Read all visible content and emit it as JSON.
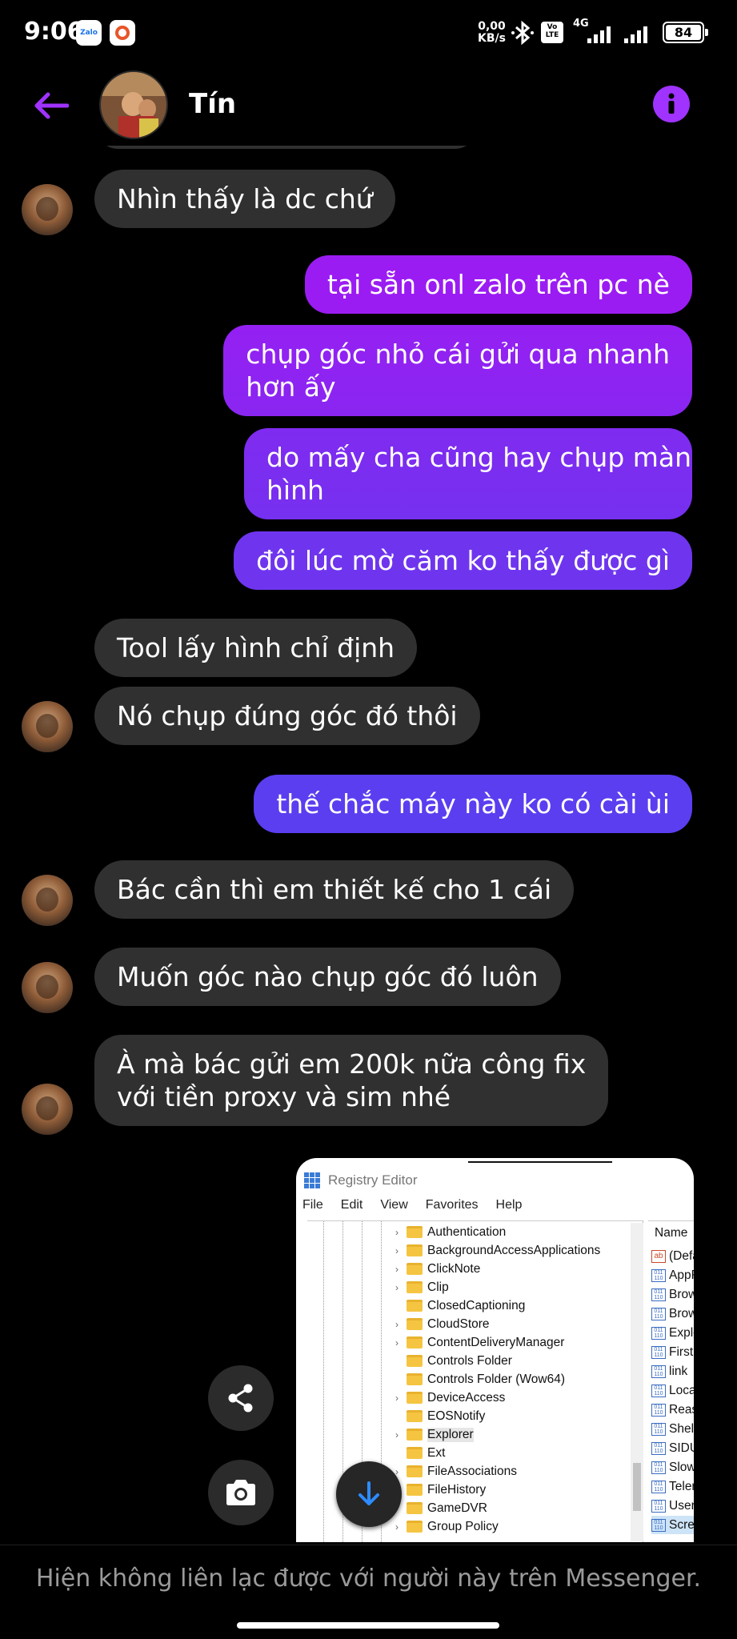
{
  "status_bar": {
    "time": "9:06",
    "zalo_badge": "Zalo",
    "net_speed_value": "0,00",
    "net_speed_unit": "KB/s",
    "volte_top": "Vo",
    "volte_bottom": "LTE",
    "network_type": "4G",
    "battery_level": "84"
  },
  "header": {
    "contact_name": "Tín",
    "back_icon": "back-arrow-icon",
    "info_icon": "info-icon"
  },
  "messages": [
    {
      "id": "m1",
      "side": "in",
      "text": "Nhìn thấy là dc chứ"
    },
    {
      "id": "m2",
      "side": "out",
      "text": "tại sẵn onl zalo trên pc nè"
    },
    {
      "id": "m3",
      "side": "out",
      "lines": [
        "chụp góc nhỏ cái gửi qua nhanh",
        "hơn ấy"
      ]
    },
    {
      "id": "m4",
      "side": "out",
      "lines": [
        "do mấy cha cũng hay chụp màn",
        "hình"
      ]
    },
    {
      "id": "m5",
      "side": "out",
      "text": "đôi lúc mờ căm ko thấy được gì"
    },
    {
      "id": "m6",
      "side": "in",
      "text": "Tool lấy hình chỉ định"
    },
    {
      "id": "m7",
      "side": "in",
      "text": "Nó chụp đúng góc đó thôi"
    },
    {
      "id": "m8",
      "side": "out",
      "text": "thế chắc máy này ko có cài ùi"
    },
    {
      "id": "m9",
      "side": "in",
      "text": "Bác cần thì em thiết kế cho 1 cái"
    },
    {
      "id": "m10",
      "side": "in",
      "text": "Muốn góc nào chụp góc đó luôn"
    },
    {
      "id": "m11",
      "side": "in",
      "lines": [
        "À mà bác gửi em 200k nữa công fix",
        "với tiền proxy và sim nhé"
      ]
    }
  ],
  "attachment": {
    "window_title": "Registry Editor",
    "menu": [
      "File",
      "Edit",
      "View",
      "Favorites",
      "Help"
    ],
    "tree_items": [
      "Authentication",
      "BackgroundAccessApplications",
      "ClickNote",
      "Clip",
      "ClosedCaptioning",
      "CloudStore",
      "ContentDeliveryManager",
      "Controls Folder",
      "Controls Folder (Wow64)",
      "DeviceAccess",
      "EOSNotify",
      "Explorer",
      "Ext",
      "FileAssociations",
      "FileHistory",
      "GameDVR",
      "Group Policy"
    ],
    "selected_tree_item": "Explorer",
    "name_column_header": "Name",
    "name_items": [
      "(Defa",
      "AppR",
      "Brow",
      "Brow",
      "Explo",
      "FirstR",
      "link",
      "Local",
      "Reaso",
      "Shell",
      "SIDU",
      "Slow",
      "Telem",
      "UserS",
      "Scree"
    ]
  },
  "actions": {
    "share_icon": "share-icon",
    "camera_icon": "camera-icon",
    "scroll_down_icon": "arrow-down-icon"
  },
  "footer": {
    "notice": "Hiện không liên lạc được với người này trên Messenger."
  },
  "colors": {
    "accent": "#a033ff",
    "incoming_bubble": "#303030",
    "outgoing_top": "#9b1cf2",
    "outgoing_bottom": "#5a3ef0"
  }
}
